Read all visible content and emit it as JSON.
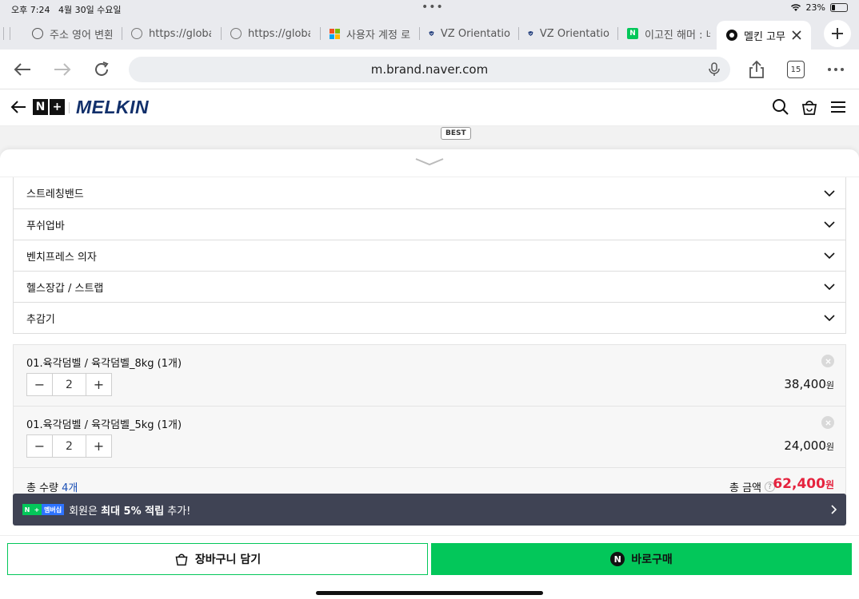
{
  "status": {
    "time": "오후 7:24",
    "date": "4월 30일 수요일",
    "dots": "•••",
    "battery": "23%",
    "battery_level": 0.23
  },
  "tabs": [
    {
      "label": "주소 영어 변환",
      "icon": "globe-icon"
    },
    {
      "label": "https://globa",
      "icon": "globe-icon"
    },
    {
      "label": "https://globa",
      "icon": "globe-icon"
    },
    {
      "label": "사용자 계정 로",
      "icon": "microsoft-icon"
    },
    {
      "label": "VZ Orientatio",
      "icon": "shield-icon"
    },
    {
      "label": "VZ Orientatio",
      "icon": "shield-icon"
    },
    {
      "label": "이고진 해머 : 네",
      "icon": "naver-icon"
    },
    {
      "label": "멜킨 고무",
      "icon": "site-icon",
      "active": true
    }
  ],
  "toolbar": {
    "url": "m.brand.naver.com",
    "tab_count": "15"
  },
  "brand": {
    "np1": "N",
    "np2": "+",
    "name": "MELKIN",
    "best_badge": "BEST"
  },
  "categories": [
    "스트레칭밴드",
    "푸쉬업바",
    "벤치프레스 의자",
    "헬스장갑 / 스트랩",
    "추감기"
  ],
  "items": [
    {
      "name": "01.육각덤벨 / 육각덤벨_8kg (1개)",
      "qty": "2",
      "price": "38,400",
      "unit": "원"
    },
    {
      "name": "01.육각덤벨 / 육각덤벨_5kg (1개)",
      "qty": "2",
      "price": "24,000",
      "unit": "원"
    }
  ],
  "stepper": {
    "minus": "−",
    "plus": "+"
  },
  "total": {
    "qty_label": "총 수량",
    "qty_value": "4개",
    "amount_label": "총 금액",
    "help": "?",
    "amount": "62,400",
    "unit": "원"
  },
  "banner": {
    "badge_n": "N",
    "badge_plus": "+",
    "badge_text": "멤버십",
    "text_pre": "회원은 ",
    "text_bold": "최대 5% 적립",
    "text_post": " 추가!"
  },
  "footer": {
    "cart_label": "장바구니 담기",
    "buy_icon": "N",
    "buy_label": "바로구매"
  },
  "colors": {
    "naver_green": "#03c75a",
    "brand_navy": "#12306b",
    "price_red": "#e5233e",
    "banner_bg": "#3f4354"
  }
}
